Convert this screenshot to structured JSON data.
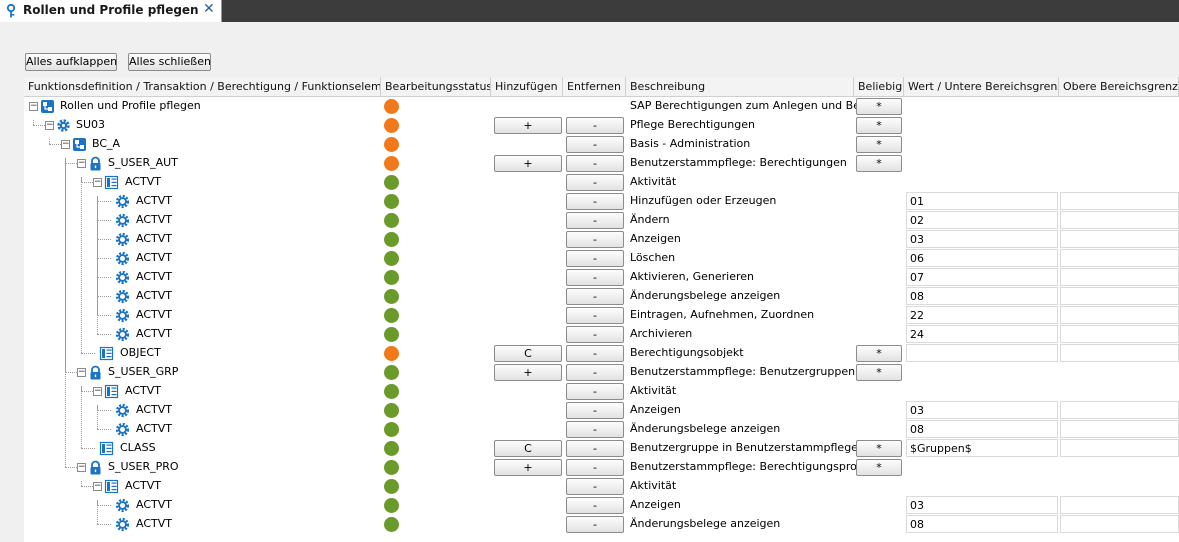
{
  "tab": {
    "title": "Rollen und Profile pflegen",
    "close": "✕"
  },
  "toolbar": {
    "expand_all": "Alles aufklappen",
    "collapse_all": "Alles schließen"
  },
  "columns": {
    "function": "Funktionsdefinition / Transaktion / Berechtigung / Funktionselement",
    "status": "Bearbeitungsstatus",
    "add": "Hinzufügen",
    "remove": "Entfernen",
    "description": "Beschreibung",
    "any": "Beliebig",
    "lower": "Wert / Untere Bereichsgrenze",
    "upper": "Obere Bereichsgrenze"
  },
  "colors": {
    "orange": "#f07a1a",
    "green": "#6a9a2a",
    "icon_blue": "#1a73c4"
  },
  "rows": [
    {
      "label": "Rollen und Profile pflegen",
      "level": 0,
      "icon": "role-icon",
      "expander": "−",
      "status": "orange",
      "add": "",
      "remove": "",
      "description": "SAP Berechtigungen zum Anlegen und Bea…",
      "any": "*",
      "value": null
    },
    {
      "label": "SU03",
      "level": 1,
      "icon": "transaction-gear-icon",
      "expander": "−",
      "status": "orange",
      "add": "+",
      "remove": "-",
      "description": "Pflege Berechtigungen",
      "any": "*",
      "value": null
    },
    {
      "label": "BC_A",
      "level": 2,
      "icon": "role-icon",
      "expander": "−",
      "status": "orange",
      "add": "",
      "remove": "-",
      "description": "Basis - Administration",
      "any": "*",
      "value": null
    },
    {
      "label": "S_USER_AUT",
      "level": 3,
      "icon": "lock-icon",
      "expander": "−",
      "status": "orange",
      "add": "+",
      "remove": "-",
      "description": "Benutzerstammpflege: Berechtigungen",
      "any": "*",
      "value": null
    },
    {
      "label": "ACTVT",
      "level": 4,
      "icon": "field-list-icon",
      "expander": "−",
      "status": "green",
      "add": "",
      "remove": "-",
      "description": "Aktivität",
      "any": "",
      "value": null
    },
    {
      "label": "ACTVT",
      "level": 5,
      "icon": "value-gear-icon",
      "expander": "",
      "status": "green",
      "add": "",
      "remove": "-",
      "description": "Hinzufügen oder Erzeugen",
      "any": "",
      "value": "01"
    },
    {
      "label": "ACTVT",
      "level": 5,
      "icon": "value-gear-icon",
      "expander": "",
      "status": "green",
      "add": "",
      "remove": "-",
      "description": "Ändern",
      "any": "",
      "value": "02"
    },
    {
      "label": "ACTVT",
      "level": 5,
      "icon": "value-gear-icon",
      "expander": "",
      "status": "green",
      "add": "",
      "remove": "-",
      "description": "Anzeigen",
      "any": "",
      "value": "03"
    },
    {
      "label": "ACTVT",
      "level": 5,
      "icon": "value-gear-icon",
      "expander": "",
      "status": "green",
      "add": "",
      "remove": "-",
      "description": "Löschen",
      "any": "",
      "value": "06"
    },
    {
      "label": "ACTVT",
      "level": 5,
      "icon": "value-gear-icon",
      "expander": "",
      "status": "green",
      "add": "",
      "remove": "-",
      "description": "Aktivieren, Generieren",
      "any": "",
      "value": "07"
    },
    {
      "label": "ACTVT",
      "level": 5,
      "icon": "value-gear-icon",
      "expander": "",
      "status": "green",
      "add": "",
      "remove": "-",
      "description": "Änderungsbelege anzeigen",
      "any": "",
      "value": "08"
    },
    {
      "label": "ACTVT",
      "level": 5,
      "icon": "value-gear-icon",
      "expander": "",
      "status": "green",
      "add": "",
      "remove": "-",
      "description": "Eintragen, Aufnehmen, Zuordnen",
      "any": "",
      "value": "22"
    },
    {
      "label": "ACTVT",
      "level": 5,
      "icon": "value-gear-icon",
      "expander": "",
      "status": "green",
      "add": "",
      "remove": "-",
      "description": "Archivieren",
      "any": "",
      "value": "24"
    },
    {
      "label": "OBJECT",
      "level": 4,
      "icon": "field-list-icon",
      "expander": "",
      "status": "orange",
      "add": "C",
      "remove": "-",
      "description": "Berechtigungsobjekt",
      "any": "*",
      "value": ""
    },
    {
      "label": "S_USER_GRP",
      "level": 3,
      "icon": "lock-icon",
      "expander": "−",
      "status": "green",
      "add": "+",
      "remove": "-",
      "description": "Benutzerstammpflege: Benutzergruppen",
      "any": "*",
      "value": null
    },
    {
      "label": "ACTVT",
      "level": 4,
      "icon": "field-list-icon",
      "expander": "−",
      "status": "green",
      "add": "",
      "remove": "-",
      "description": "Aktivität",
      "any": "",
      "value": null
    },
    {
      "label": "ACTVT",
      "level": 5,
      "icon": "value-gear-icon",
      "expander": "",
      "status": "green",
      "add": "",
      "remove": "-",
      "description": "Anzeigen",
      "any": "",
      "value": "03"
    },
    {
      "label": "ACTVT",
      "level": 5,
      "icon": "value-gear-icon",
      "expander": "",
      "status": "green",
      "add": "",
      "remove": "-",
      "description": "Änderungsbelege anzeigen",
      "any": "",
      "value": "08"
    },
    {
      "label": "CLASS",
      "level": 4,
      "icon": "field-list-icon",
      "expander": "",
      "status": "green",
      "add": "C",
      "remove": "-",
      "description": "Benutzergruppe in Benutzerstammpflege",
      "any": "*",
      "value": "$Gruppen$"
    },
    {
      "label": "S_USER_PRO",
      "level": 3,
      "icon": "lock-icon",
      "expander": "−",
      "status": "green",
      "add": "+",
      "remove": "-",
      "description": "Benutzerstammpflege: Berechtigungsprofil",
      "any": "*",
      "value": null
    },
    {
      "label": "ACTVT",
      "level": 4,
      "icon": "field-list-icon",
      "expander": "−",
      "status": "green",
      "add": "",
      "remove": "-",
      "description": "Aktivität",
      "any": "",
      "value": null
    },
    {
      "label": "ACTVT",
      "level": 5,
      "icon": "value-gear-icon",
      "expander": "",
      "status": "green",
      "add": "",
      "remove": "-",
      "description": "Anzeigen",
      "any": "",
      "value": "03"
    },
    {
      "label": "ACTVT",
      "level": 5,
      "icon": "value-gear-icon",
      "expander": "",
      "status": "green",
      "add": "",
      "remove": "-",
      "description": "Änderungsbelege anzeigen",
      "any": "",
      "value": "08"
    }
  ]
}
